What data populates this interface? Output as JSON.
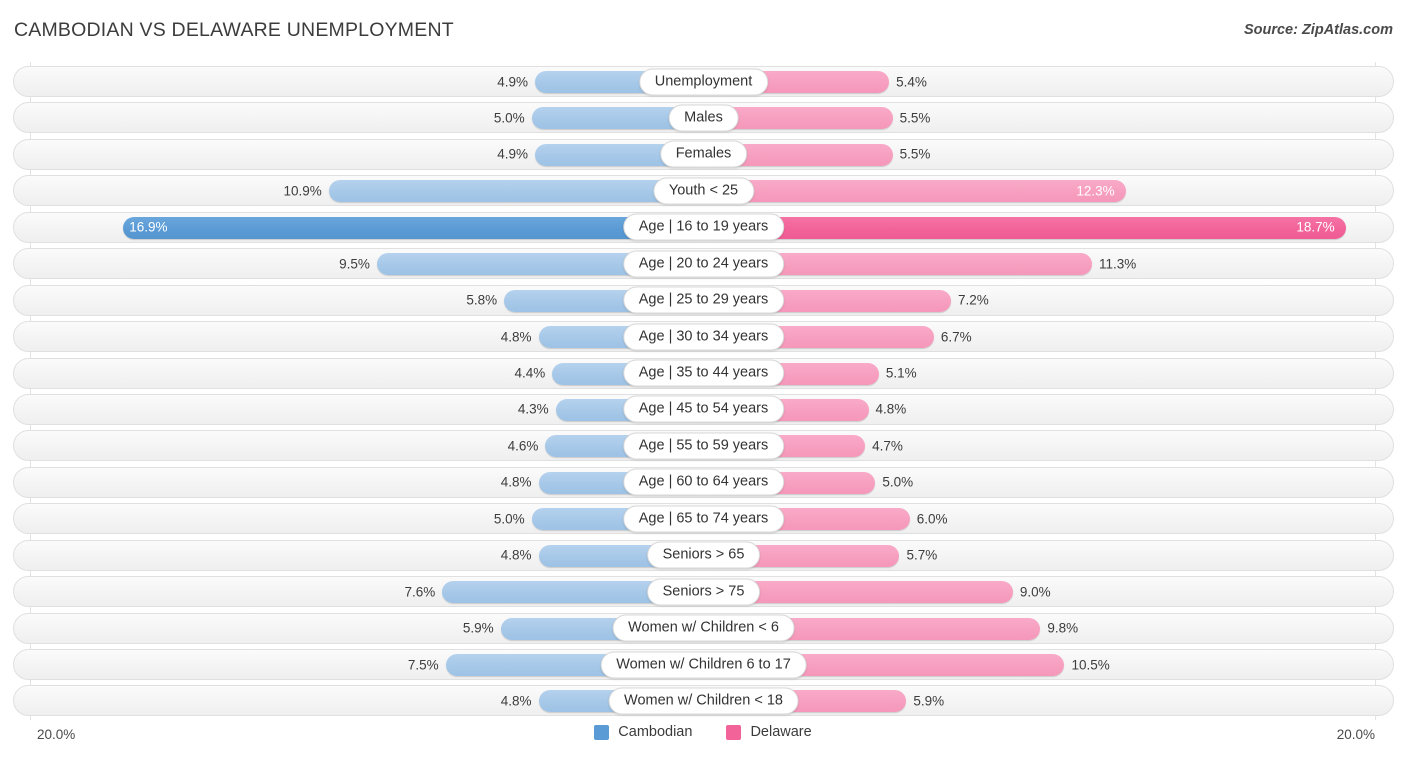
{
  "header": {
    "title": "CAMBODIAN VS DELAWARE UNEMPLOYMENT",
    "source": "Source: ZipAtlas.com"
  },
  "footer": {
    "axis_left": "20.0%",
    "axis_right": "20.0%",
    "legend": [
      {
        "label": "Cambodian",
        "color": "#5b9bd5",
        "icon": "square-swatch"
      },
      {
        "label": "Delaware",
        "color": "#f2639a",
        "icon": "square-swatch"
      }
    ]
  },
  "chart_data": {
    "type": "bar",
    "orientation": "diverging-horizontal",
    "title": "CAMBODIAN VS DELAWARE UNEMPLOYMENT",
    "subtitle": "",
    "xlabel": "",
    "ylabel": "",
    "xlim": [
      0,
      20.0
    ],
    "axis_max_label": "20.0%",
    "grid": true,
    "legend_position": "bottom-center",
    "colors": {
      "cambodian_light": "#a6c8e8",
      "cambodian_dark": "#5b9bd5",
      "delaware_light": "#f79fc0",
      "delaware_dark": "#f2639a"
    },
    "categories": [
      "Unemployment",
      "Males",
      "Females",
      "Youth < 25",
      "Age | 16 to 19 years",
      "Age | 20 to 24 years",
      "Age | 25 to 29 years",
      "Age | 30 to 34 years",
      "Age | 35 to 44 years",
      "Age | 45 to 54 years",
      "Age | 55 to 59 years",
      "Age | 60 to 64 years",
      "Age | 65 to 74 years",
      "Seniors > 65",
      "Seniors > 75",
      "Women w/ Children < 6",
      "Women w/ Children 6 to 17",
      "Women w/ Children < 18"
    ],
    "series": [
      {
        "name": "Cambodian",
        "values": [
          4.9,
          5.0,
          4.9,
          10.9,
          16.9,
          9.5,
          5.8,
          4.8,
          4.4,
          4.3,
          4.6,
          4.8,
          5.0,
          4.8,
          7.6,
          5.9,
          7.5,
          4.8
        ],
        "labels": [
          "4.9%",
          "5.0%",
          "4.9%",
          "10.9%",
          "16.9%",
          "9.5%",
          "5.8%",
          "4.8%",
          "4.4%",
          "4.3%",
          "4.6%",
          "4.8%",
          "5.0%",
          "4.8%",
          "7.6%",
          "5.9%",
          "7.5%",
          "4.8%"
        ]
      },
      {
        "name": "Delaware",
        "values": [
          5.4,
          5.5,
          5.5,
          12.3,
          18.7,
          11.3,
          7.2,
          6.7,
          5.1,
          4.8,
          4.7,
          5.0,
          6.0,
          5.7,
          9.0,
          9.8,
          10.5,
          5.9
        ],
        "labels": [
          "5.4%",
          "5.5%",
          "5.5%",
          "12.3%",
          "18.7%",
          "11.3%",
          "7.2%",
          "6.7%",
          "5.1%",
          "4.8%",
          "4.7%",
          "5.0%",
          "6.0%",
          "5.7%",
          "9.0%",
          "9.8%",
          "10.5%",
          "5.9%"
        ]
      }
    ],
    "rows": [
      {
        "label": "Unemployment",
        "left": 4.9,
        "left_label": "4.9%",
        "right": 5.4,
        "right_label": "5.4%",
        "highlight": false
      },
      {
        "label": "Males",
        "left": 5.0,
        "left_label": "5.0%",
        "right": 5.5,
        "right_label": "5.5%",
        "highlight": false
      },
      {
        "label": "Females",
        "left": 4.9,
        "left_label": "4.9%",
        "right": 5.5,
        "right_label": "5.5%",
        "highlight": false
      },
      {
        "label": "Youth < 25",
        "left": 10.9,
        "left_label": "10.9%",
        "right": 12.3,
        "right_label": "12.3%",
        "highlight": false,
        "right_inside": true
      },
      {
        "label": "Age | 16 to 19 years",
        "left": 16.9,
        "left_label": "16.9%",
        "right": 18.7,
        "right_label": "18.7%",
        "highlight": true,
        "left_inside": true,
        "right_inside": true
      },
      {
        "label": "Age | 20 to 24 years",
        "left": 9.5,
        "left_label": "9.5%",
        "right": 11.3,
        "right_label": "11.3%",
        "highlight": false
      },
      {
        "label": "Age | 25 to 29 years",
        "left": 5.8,
        "left_label": "5.8%",
        "right": 7.2,
        "right_label": "7.2%",
        "highlight": false
      },
      {
        "label": "Age | 30 to 34 years",
        "left": 4.8,
        "left_label": "4.8%",
        "right": 6.7,
        "right_label": "6.7%",
        "highlight": false
      },
      {
        "label": "Age | 35 to 44 years",
        "left": 4.4,
        "left_label": "4.4%",
        "right": 5.1,
        "right_label": "5.1%",
        "highlight": false
      },
      {
        "label": "Age | 45 to 54 years",
        "left": 4.3,
        "left_label": "4.3%",
        "right": 4.8,
        "right_label": "4.8%",
        "highlight": false
      },
      {
        "label": "Age | 55 to 59 years",
        "left": 4.6,
        "left_label": "4.6%",
        "right": 4.7,
        "right_label": "4.7%",
        "highlight": false
      },
      {
        "label": "Age | 60 to 64 years",
        "left": 4.8,
        "left_label": "4.8%",
        "right": 5.0,
        "right_label": "5.0%",
        "highlight": false
      },
      {
        "label": "Age | 65 to 74 years",
        "left": 5.0,
        "left_label": "5.0%",
        "right": 6.0,
        "right_label": "6.0%",
        "highlight": false
      },
      {
        "label": "Seniors > 65",
        "left": 4.8,
        "left_label": "4.8%",
        "right": 5.7,
        "right_label": "5.7%",
        "highlight": false
      },
      {
        "label": "Seniors > 75",
        "left": 7.6,
        "left_label": "7.6%",
        "right": 9.0,
        "right_label": "9.0%",
        "highlight": false
      },
      {
        "label": "Women w/ Children < 6",
        "left": 5.9,
        "left_label": "5.9%",
        "right": 9.8,
        "right_label": "9.8%",
        "highlight": false
      },
      {
        "label": "Women w/ Children 6 to 17",
        "left": 7.5,
        "left_label": "7.5%",
        "right": 10.5,
        "right_label": "10.5%",
        "highlight": false
      },
      {
        "label": "Women w/ Children < 18",
        "left": 4.8,
        "left_label": "4.8%",
        "right": 5.9,
        "right_label": "5.9%",
        "highlight": false
      }
    ]
  }
}
